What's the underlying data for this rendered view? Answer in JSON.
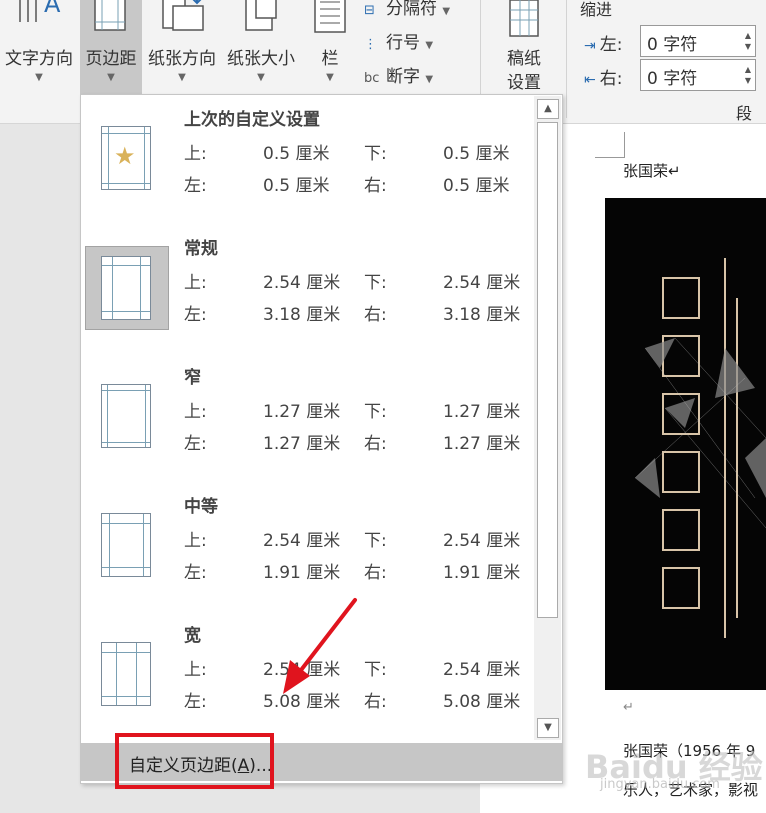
{
  "ribbon": {
    "buttons": [
      {
        "label": "文字方向",
        "icon": "text-direction-icon"
      },
      {
        "label": "页边距",
        "icon": "margins-icon"
      },
      {
        "label": "纸张方向",
        "icon": "orientation-icon"
      },
      {
        "label": "纸张大小",
        "icon": "page-size-icon"
      },
      {
        "label": "栏",
        "icon": "columns-icon"
      }
    ],
    "small": [
      {
        "label": "分隔符",
        "icon": "breaks-icon"
      },
      {
        "label": "行号",
        "icon": "line-numbers-icon"
      },
      {
        "label": "断字",
        "icon": "hyphenation-icon"
      }
    ],
    "manuscript": {
      "line1": "稿纸",
      "line2": "设置",
      "icon": "manuscript-icon"
    },
    "indent": {
      "title": "缩进",
      "left_label": "左:",
      "left_value": "0 字符",
      "right_label": "右:",
      "right_value": "0 字符"
    },
    "section_label": "段落"
  },
  "dropdown": {
    "presets": [
      {
        "name": "上次的自定义设置",
        "top_label": "上:",
        "top": "0.5 厘米",
        "bottom_label": "下:",
        "bottom": "0.5 厘米",
        "left_label": "左:",
        "left": "0.5 厘米",
        "right_label": "右:",
        "right": "0.5 厘米"
      },
      {
        "name": "常规",
        "top_label": "上:",
        "top": "2.54 厘米",
        "bottom_label": "下:",
        "bottom": "2.54 厘米",
        "left_label": "左:",
        "left": "3.18 厘米",
        "right_label": "右:",
        "right": "3.18 厘米"
      },
      {
        "name": "窄",
        "top_label": "上:",
        "top": "1.27 厘米",
        "bottom_label": "下:",
        "bottom": "1.27 厘米",
        "left_label": "左:",
        "left": "1.27 厘米",
        "right_label": "右:",
        "right": "1.27 厘米"
      },
      {
        "name": "中等",
        "top_label": "上:",
        "top": "2.54 厘米",
        "bottom_label": "下:",
        "bottom": "2.54 厘米",
        "left_label": "左:",
        "left": "1.91 厘米",
        "right_label": "右:",
        "right": "1.91 厘米"
      },
      {
        "name": "宽",
        "top_label": "上:",
        "top": "2.54 厘米",
        "bottom_label": "下:",
        "bottom": "2.54 厘米",
        "left_label": "左:",
        "left": "5.08 厘米",
        "right_label": "右:",
        "right": "5.08 厘米"
      }
    ],
    "custom_prefix": "自定义页边距(",
    "custom_key": "A",
    "custom_suffix": ")..."
  },
  "document": {
    "name": "张国荣↵",
    "para_mark": "↵",
    "line1": "张国荣（1956 年 9",
    "line2": "乐人，艺术家，影视"
  },
  "watermark": {
    "text": "Baidu 经验",
    "sub": "jingyan.baidu.com"
  },
  "colors": {
    "highlight_box": "#e0141e",
    "arrow": "#e0141e",
    "selected_thumb": "#c6c6c6",
    "star": "#d9b25a"
  }
}
